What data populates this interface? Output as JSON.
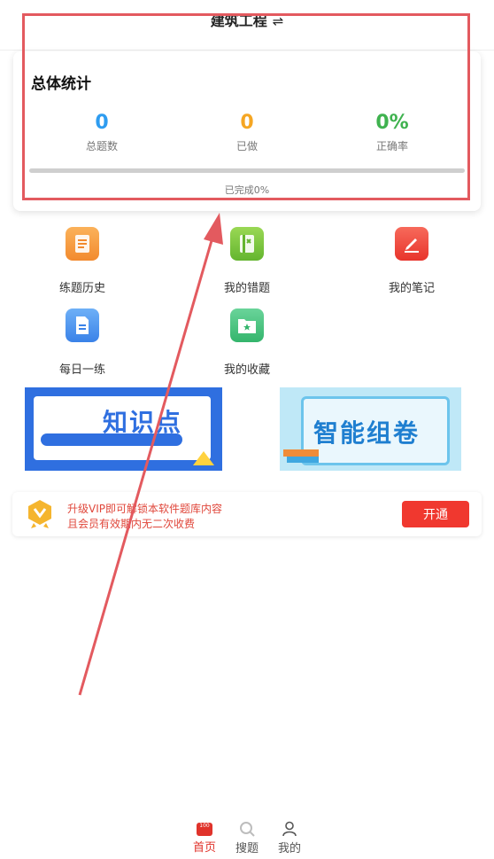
{
  "header": {
    "title": "建筑工程",
    "switch_icon": "⇌"
  },
  "stats": {
    "title": "总体统计",
    "items": [
      {
        "value": "0",
        "label": "总题数",
        "color": "#2e9cf0"
      },
      {
        "value": "0",
        "label": "已做",
        "color": "#f5a623"
      },
      {
        "value": "0%",
        "label": "正确率",
        "color": "#3fb24f"
      }
    ],
    "progress_fraction": 0,
    "progress_text": "已完成0%"
  },
  "grid": [
    {
      "label": "练题历史",
      "icon": "book-icon",
      "color": "#f5973a"
    },
    {
      "label": "我的错题",
      "icon": "wrong-book-icon",
      "color": "#7ac43c"
    },
    {
      "label": "我的笔记",
      "icon": "edit-icon",
      "color": "#f0413a"
    },
    {
      "label": "每日一练",
      "icon": "document-icon",
      "color": "#3e8ef0"
    },
    {
      "label": "我的收藏",
      "icon": "star-folder-icon",
      "color": "#44c07a"
    }
  ],
  "banners": [
    {
      "text": "知识点"
    },
    {
      "text": "智能组卷"
    }
  ],
  "vip": {
    "line1": "升级VIP即可解锁本软件题库内容",
    "line2": "且会员有效期内无二次收费",
    "button": "开通"
  },
  "tabbar": [
    {
      "label": "首页",
      "icon": "home-icon",
      "active": true
    },
    {
      "label": "搜题",
      "icon": "search-question-icon",
      "active": false
    },
    {
      "label": "我的",
      "icon": "user-icon",
      "active": false
    }
  ],
  "colors": {
    "accent": "#e0332b",
    "highlight": "#e35a5f"
  }
}
